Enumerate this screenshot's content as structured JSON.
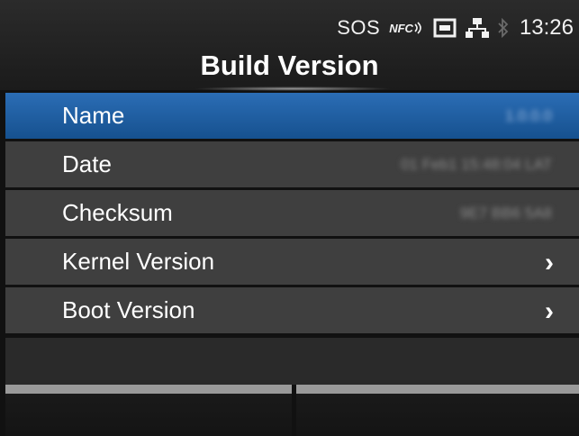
{
  "status": {
    "sos": "SOS",
    "nfc": "NFC",
    "time": "13:26",
    "icons": [
      "nfc-icon",
      "sd-card-icon",
      "network-icon",
      "bluetooth-icon"
    ]
  },
  "header": {
    "title": "Build Version"
  },
  "menu": {
    "items": [
      {
        "label": "Name",
        "value": "1.0.0.0",
        "selected": true
      },
      {
        "label": "Date",
        "value": "01 Feb1 15:48:04 LAT",
        "selected": false
      },
      {
        "label": "Checksum",
        "value": "9E7 BB6 5A8",
        "selected": false
      },
      {
        "label": "Kernel Version",
        "chevron": "›",
        "selected": false
      },
      {
        "label": "Boot Version",
        "chevron": "›",
        "selected": false
      }
    ]
  },
  "softkeys": {
    "left_label": "",
    "right_label": ""
  },
  "colors": {
    "accent": "#1f5fa3",
    "row": "#3f3f3f",
    "background": "#111111"
  }
}
